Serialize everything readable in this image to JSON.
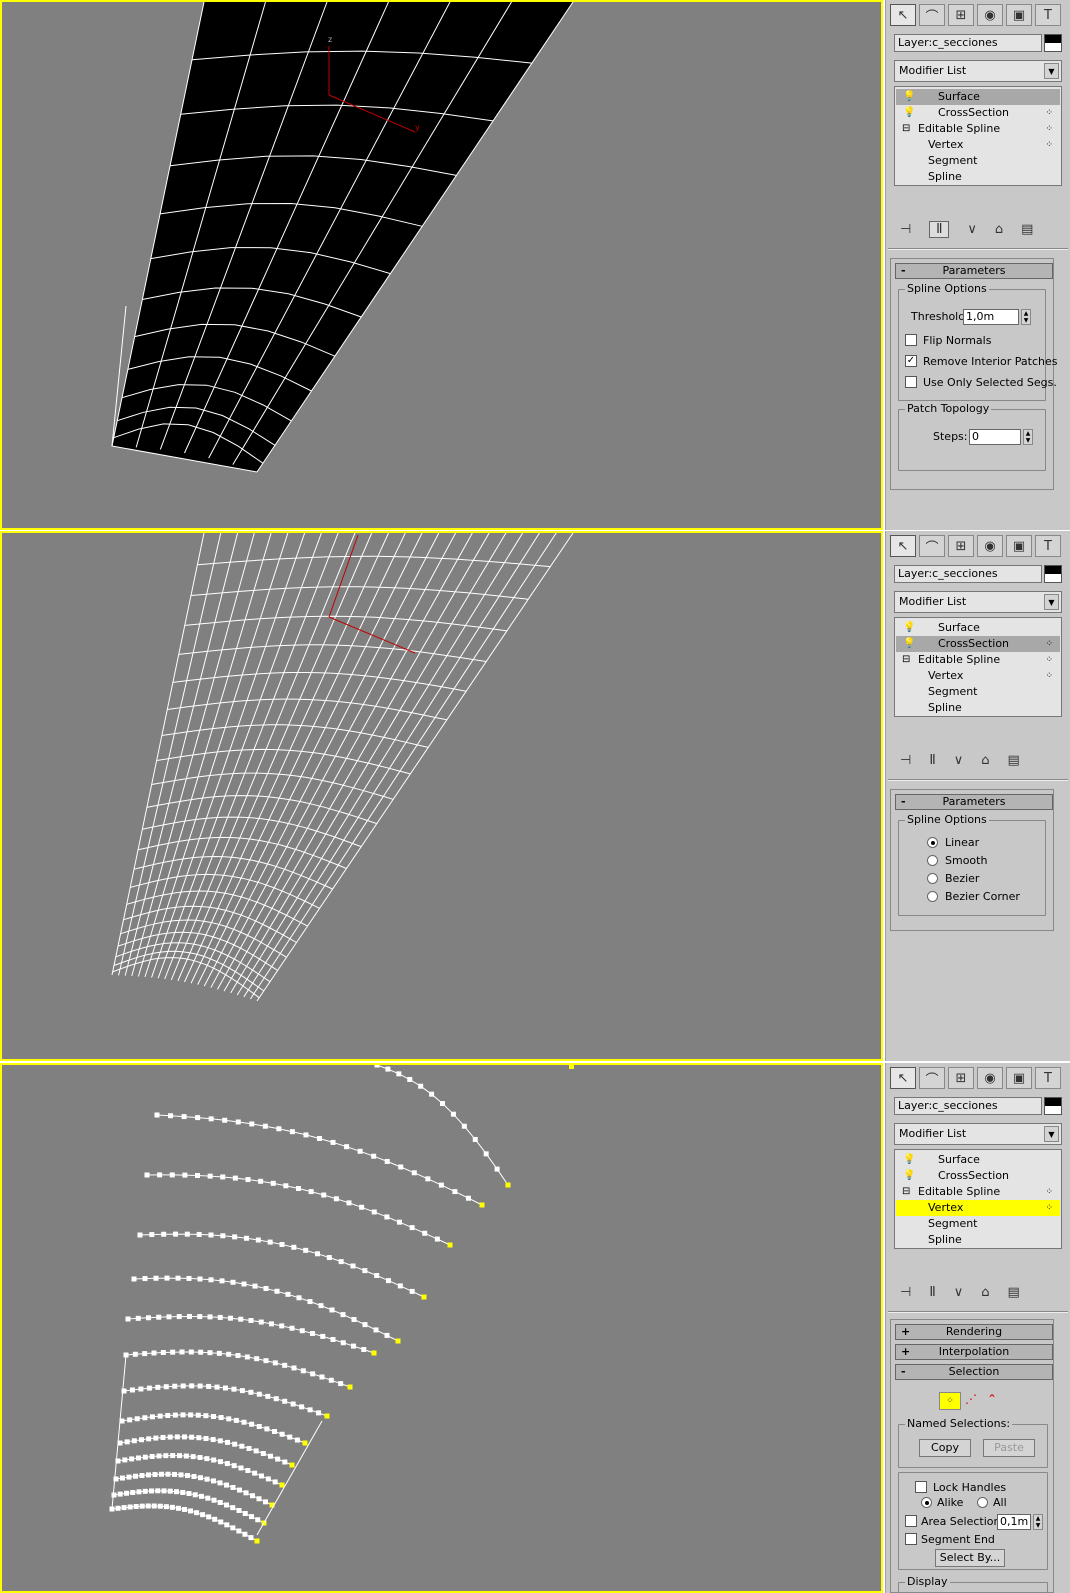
{
  "colors": {
    "viewport_bg": "#808080",
    "viewport_border": "#ffff00",
    "mesh": "#ffffff",
    "surface": "#000000",
    "axis": "#c00000",
    "vertex_end": "#ffff00",
    "panel": "#c8c8c8",
    "highlight": "#ffff00"
  },
  "toolbar": {
    "icons": [
      "pointer-arrow-icon",
      "curve-icon",
      "hierarchy-icon",
      "motion-icon",
      "display-icon",
      "hammer-icon"
    ]
  },
  "panels": [
    {
      "layer": "Layer:c_secciones",
      "modifier_list": "Modifier List",
      "stack": [
        {
          "label": "Surface",
          "type": "bulb",
          "selected": true
        },
        {
          "label": "CrossSection",
          "type": "bulb",
          "selected": false
        },
        {
          "label": "Editable Spline",
          "type": "tree"
        },
        {
          "label": "Vertex",
          "type": "sub"
        },
        {
          "label": "Segment",
          "type": "sub"
        },
        {
          "label": "Spline",
          "type": "sub"
        }
      ],
      "rollout": "Parameters",
      "params": {
        "spline_options": "Spline Options",
        "threshold_label": "Threshold:",
        "threshold": "1,0m",
        "flip_normals": "Flip Normals",
        "remove_interior": "Remove Interior Patches",
        "use_only_selected": "Use Only Selected Segs.",
        "patch_topology": "Patch Topology",
        "steps_label": "Steps:",
        "steps": "0"
      }
    },
    {
      "layer": "Layer:c_secciones",
      "modifier_list": "Modifier List",
      "stack": [
        {
          "label": "Surface",
          "type": "bulb",
          "selected": false
        },
        {
          "label": "CrossSection",
          "type": "bulb",
          "selected": true
        },
        {
          "label": "Editable Spline",
          "type": "tree"
        },
        {
          "label": "Vertex",
          "type": "sub"
        },
        {
          "label": "Segment",
          "type": "sub"
        },
        {
          "label": "Spline",
          "type": "sub"
        }
      ],
      "rollout": "Parameters",
      "params": {
        "spline_options": "Spline Options",
        "linear": "Linear",
        "smooth": "Smooth",
        "bezier": "Bezier",
        "bezier_corner": "Bezier Corner"
      }
    },
    {
      "layer": "Layer:c_secciones",
      "modifier_list": "Modifier List",
      "stack": [
        {
          "label": "Surface",
          "type": "bulb",
          "selected": false
        },
        {
          "label": "CrossSection",
          "type": "bulb",
          "selected": false
        },
        {
          "label": "Editable Spline",
          "type": "tree"
        },
        {
          "label": "Vertex",
          "type": "sub"
        },
        {
          "label": "Segment",
          "type": "sub"
        },
        {
          "label": "Spline",
          "type": "sub"
        }
      ],
      "rollouts": {
        "rendering": "Rendering",
        "interpolation": "Interpolation",
        "selection": "Selection"
      },
      "params": {
        "named_selections": "Named Selections:",
        "copy": "Copy",
        "paste": "Paste",
        "lock_handles": "Lock Handles",
        "alike": "Alike",
        "all": "All",
        "area_selection": "Area Selection:",
        "area_value": "0,1m",
        "segment_end": "Segment End",
        "select_by": "Select By...",
        "display": "Display"
      }
    }
  ],
  "axis_labels": {
    "z": "z",
    "y": "y"
  }
}
